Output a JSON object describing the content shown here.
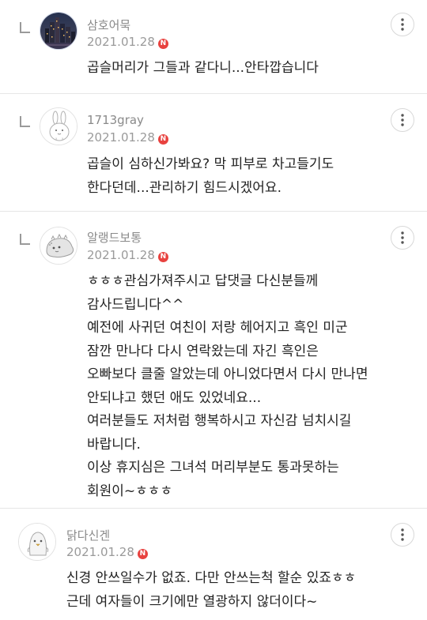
{
  "comments": [
    {
      "nickname": "삼호어묵",
      "date": "2021.01.28",
      "new_badge": "N",
      "lines": [
        "곱슬머리가 그들과 같다니...안타깝습니다"
      ]
    },
    {
      "nickname": "1713gray",
      "date": "2021.01.28",
      "new_badge": "N",
      "lines": [
        "곱슬이 심하신가봐요? 막 피부로 차고들기도",
        "한다던데...관리하기 힘드시겠어요."
      ]
    },
    {
      "nickname": "알랭드보통",
      "date": "2021.01.28",
      "new_badge": "N",
      "lines": [
        "ㅎㅎㅎ관심가져주시고 답댓글 다신분들께",
        "감사드립니다^^",
        "예전에 사귀던 여친이 저랑 헤어지고 흑인 미군",
        "잠깐 만나다 다시 연락왔는데 자긴 흑인은",
        "오빠보다 클줄 알았는데 아니었다면서 다시 만나면",
        "안되냐고 했던 애도 있었네요...",
        "여러분들도 저처럼 행복하시고 자신감 넘치시길",
        "바랍니다.",
        "이상 휴지심은 그녀석 머리부분도 통과못하는",
        "회원이~ㅎㅎㅎ"
      ]
    },
    {
      "nickname": "닭다신겐",
      "date": "2021.01.28",
      "new_badge": "N",
      "lines": [
        "신경 안쓰일수가 없죠. 다만 안쓰는척 할순 있죠ㅎㅎ",
        "근데 여자들이 크기에만 열광하지 않더이다~"
      ]
    }
  ]
}
